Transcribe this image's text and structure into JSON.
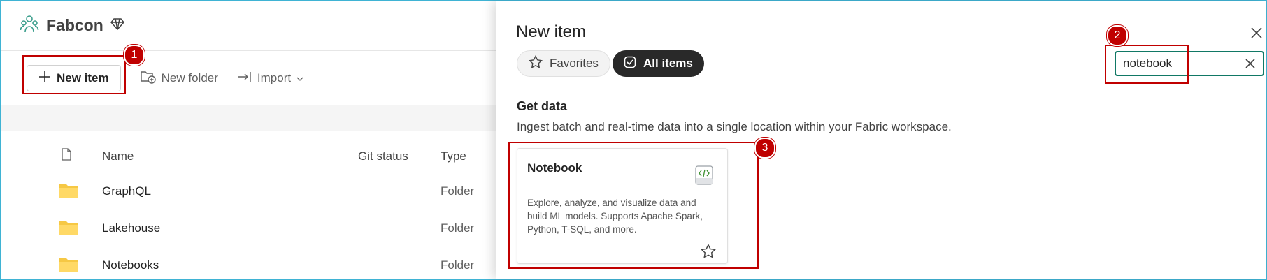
{
  "workspace": {
    "title": "Fabcon",
    "toolbar": {
      "new_item": "New item",
      "new_folder": "New folder",
      "import": "Import"
    },
    "table": {
      "headers": {
        "name": "Name",
        "git_status": "Git status",
        "type": "Type"
      },
      "rows": [
        {
          "name": "GraphQL",
          "type": "Folder"
        },
        {
          "name": "Lakehouse",
          "type": "Folder"
        },
        {
          "name": "Notebooks",
          "type": "Folder"
        }
      ]
    }
  },
  "panel": {
    "title": "New item",
    "chips": {
      "favorites": "Favorites",
      "all_items": "All items"
    },
    "search": {
      "value": "notebook"
    },
    "section": {
      "title": "Get data",
      "description": "Ingest batch and real-time data into a single location within your Fabric workspace."
    },
    "card": {
      "title": "Notebook",
      "description": "Explore, analyze, and visualize data and build ML models. Supports Apache Spark, Python, T-SQL, and more."
    }
  },
  "annotations": {
    "step1": "1",
    "step2": "2",
    "step3": "3"
  },
  "colors": {
    "annotation": "#c00000",
    "accent": "#117865",
    "frame": "#3fb3d4"
  },
  "icons": [
    "workspace-icon",
    "diamond-icon",
    "plus-icon",
    "new-folder-icon",
    "import-icon",
    "chevron-down-icon",
    "file-icon",
    "folder-icon",
    "close-icon",
    "star-icon",
    "check-square-icon",
    "notebook-icon"
  ]
}
